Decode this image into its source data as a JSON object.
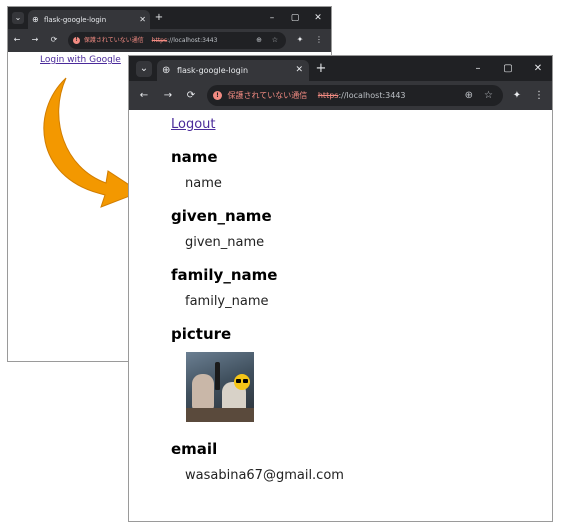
{
  "back_window": {
    "tab_title": "flask-google-login",
    "address": {
      "security_label": "保護されていない通信",
      "scheme": "https",
      "rest": "://localhost:3443"
    },
    "login_link": "Login with Google"
  },
  "front_window": {
    "tab_title": "flask-google-login",
    "address": {
      "security_label": "保護されていない通信",
      "scheme": "https",
      "rest": "://localhost:3443"
    },
    "logout_link": "Logout",
    "fields": [
      {
        "heading": "name",
        "value": "name"
      },
      {
        "heading": "given_name",
        "value": "given_name"
      },
      {
        "heading": "family_name",
        "value": "family_name"
      },
      {
        "heading": "picture"
      },
      {
        "heading": "email",
        "value": "wasabina67@gmail.com"
      }
    ]
  },
  "icons": {
    "tab_list": "chevron-down-icon",
    "favicon": "globe-icon",
    "close_tab": "close-icon",
    "new_tab": "plus-icon",
    "minimize": "minimize-icon",
    "maximize": "maximize-icon",
    "close_window": "close-icon",
    "back": "back-arrow-icon",
    "forward": "forward-arrow-icon",
    "reload": "reload-icon",
    "security_warning": "warning-icon",
    "zoom": "zoom-icon",
    "bookmark": "star-icon",
    "extensions": "extension-icon",
    "menu": "kebab-menu-icon",
    "transition_arrow": "curved-arrow"
  },
  "colors": {
    "arrow": "#f39800",
    "link": "#4a2a9a",
    "browser_chrome": "#35363a",
    "tab_strip": "#202124"
  }
}
